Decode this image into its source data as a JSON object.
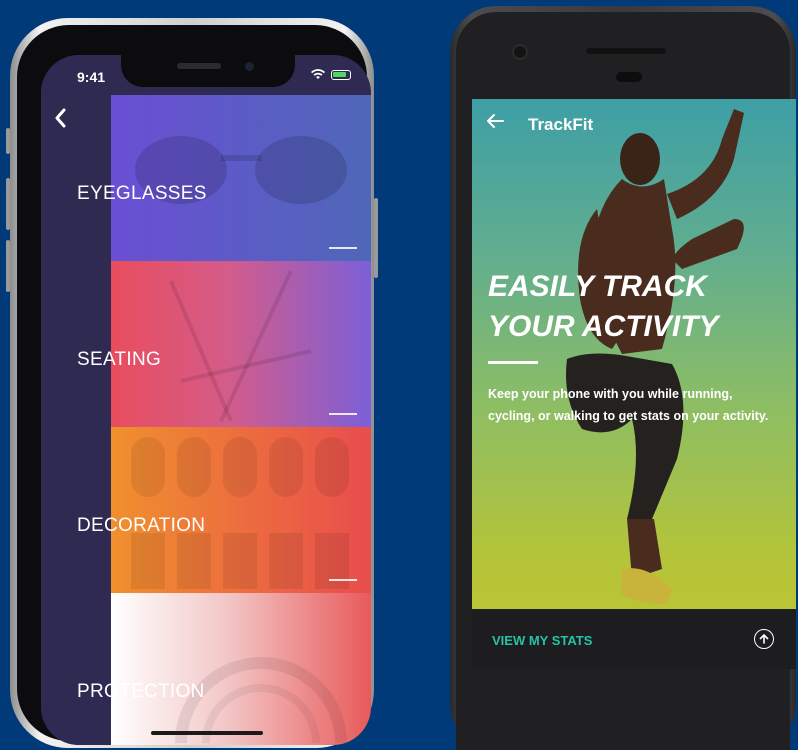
{
  "iphone": {
    "status_time": "9:41",
    "back_icon": "chevron-left-icon",
    "categories": [
      {
        "label": "EYEGLASSES",
        "colors": [
          "#6a4fd4",
          "#4f67b8"
        ]
      },
      {
        "label": "SEATING",
        "colors": [
          "#e94d5d",
          "#7c5fd8"
        ]
      },
      {
        "label": "DECORATION",
        "colors": [
          "#f0902e",
          "#e84d4d"
        ]
      },
      {
        "label": "PROTECTION",
        "colors": [
          "#ffffff",
          "#e85a5a"
        ]
      }
    ]
  },
  "android": {
    "app_title": "TrackFit",
    "back_icon": "arrow-left-icon",
    "hero_title_line1": "EASILY TRACK",
    "hero_title_line2": "YOUR ACTIVITY",
    "hero_subtitle": "Keep your phone with you while running, cycling, or walking to get stats on your activity.",
    "cta_label": "VIEW MY STATS",
    "cta_icon": "arrow-up-circle-icon",
    "accent": "#27c2a4"
  }
}
